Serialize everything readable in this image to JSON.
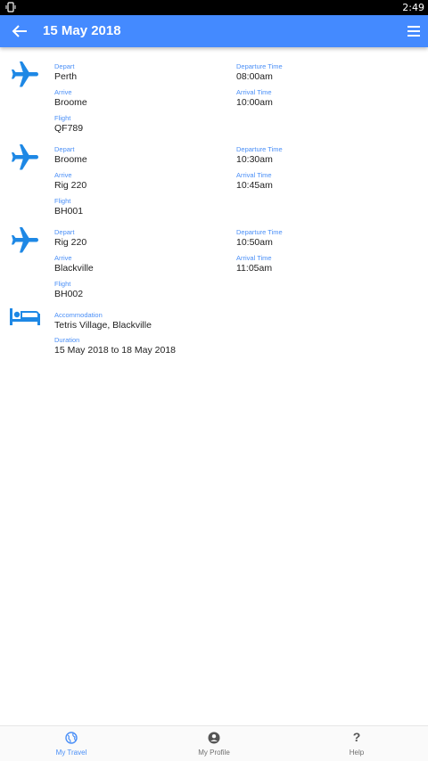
{
  "status_bar": {
    "time": "2:49"
  },
  "app_bar": {
    "title": "15 May 2018"
  },
  "labels": {
    "depart": "Depart",
    "departure_time": "Departure Time",
    "arrive": "Arrive",
    "arrival_time": "Arrival Time",
    "flight": "Flight",
    "accommodation": "Accommodation",
    "duration": "Duration"
  },
  "flights": [
    {
      "depart": "Perth",
      "departure_time": "08:00am",
      "arrive": "Broome",
      "arrival_time": "10:00am",
      "flight": "QF789"
    },
    {
      "depart": "Broome",
      "departure_time": "10:30am",
      "arrive": "Rig 220",
      "arrival_time": "10:45am",
      "flight": "BH001"
    },
    {
      "depart": "Rig 220",
      "departure_time": "10:50am",
      "arrive": "Blackville",
      "arrival_time": "11:05am",
      "flight": "BH002"
    }
  ],
  "accommodation": {
    "place": "Tetris Village, Blackville",
    "duration": "15 May 2018 to 18 May 2018"
  },
  "bottom_nav": [
    {
      "label": "My Travel",
      "icon": "globe-icon",
      "active": true
    },
    {
      "label": "My Profile",
      "icon": "account-circle-icon",
      "active": false
    },
    {
      "label": "Help",
      "icon": "help-icon",
      "active": false
    }
  ],
  "colors": {
    "accent": "#448aff",
    "label_blue": "#4a8ff7",
    "icon_blue": "#1e88e5"
  }
}
